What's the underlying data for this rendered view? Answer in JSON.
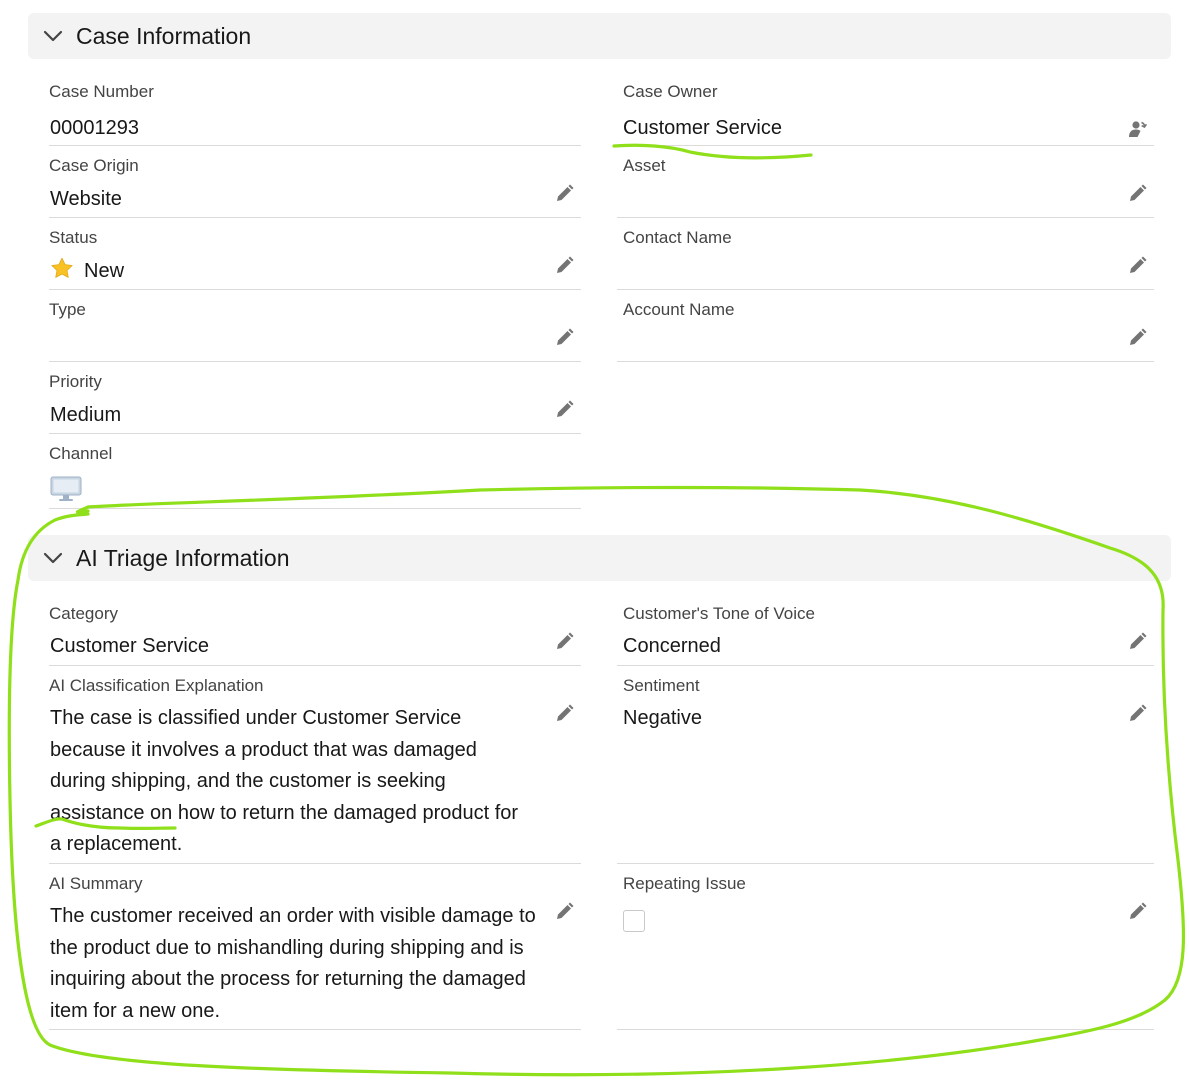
{
  "sections": {
    "case_information": {
      "title": "Case Information",
      "fields": {
        "case_number": {
          "label": "Case Number",
          "value": "00001293"
        },
        "case_owner": {
          "label": "Case Owner",
          "value": "Customer Service",
          "icon": "change-owner-icon"
        },
        "case_origin": {
          "label": "Case Origin",
          "value": "Website"
        },
        "asset": {
          "label": "Asset",
          "value": ""
        },
        "status": {
          "label": "Status",
          "value": "New",
          "icon": "star-icon"
        },
        "contact_name": {
          "label": "Contact Name",
          "value": ""
        },
        "type": {
          "label": "Type",
          "value": ""
        },
        "account_name": {
          "label": "Account Name",
          "value": ""
        },
        "priority": {
          "label": "Priority",
          "value": "Medium"
        },
        "channel": {
          "label": "Channel",
          "icon": "desktop-monitor-icon"
        }
      }
    },
    "ai_triage": {
      "title": "AI Triage Information",
      "fields": {
        "category": {
          "label": "Category",
          "value": "Customer Service"
        },
        "tone": {
          "label": "Customer's Tone of Voice",
          "value": "Concerned"
        },
        "explanation": {
          "label": "AI Classification Explanation",
          "value": "The case is classified under Customer Service because it involves a product that was damaged during shipping, and the customer is seeking assistance on how to return the damaged product for a replacement."
        },
        "sentiment": {
          "label": "Sentiment",
          "value": "Negative"
        },
        "summary": {
          "label": "AI Summary",
          "value": "The customer received an order with visible damage to the product due to mishandling during shipping and is inquiring about the process for returning the damaged item for a new one."
        },
        "repeating_issue": {
          "label": "Repeating Issue",
          "checked": false
        }
      }
    }
  },
  "colors": {
    "annotation": "#8fdf1a",
    "header_bg": "#f3f3f3",
    "divider": "#dddbda",
    "label": "#444444",
    "edit_icon": "#747474"
  }
}
